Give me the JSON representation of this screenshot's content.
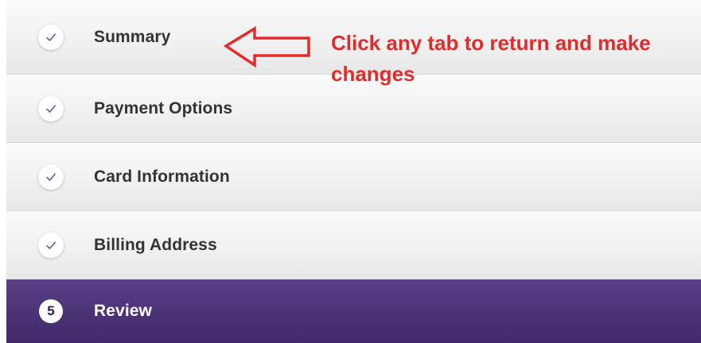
{
  "steps": [
    {
      "label": "Summary",
      "status": "completed",
      "icon": "check-icon"
    },
    {
      "label": "Payment Options",
      "status": "completed",
      "icon": "check-icon"
    },
    {
      "label": "Card Information",
      "status": "completed",
      "icon": "check-icon"
    },
    {
      "label": "Billing Address",
      "status": "completed",
      "icon": "check-icon"
    },
    {
      "label": "Review",
      "status": "current",
      "number": "5"
    }
  ],
  "annotation": {
    "text": "Click any tab to return and make changes",
    "color": "#e32b2b"
  },
  "colors": {
    "active_step": "#4b3276",
    "inactive_step": "#f1f1f1",
    "check": "#6d5a91"
  }
}
